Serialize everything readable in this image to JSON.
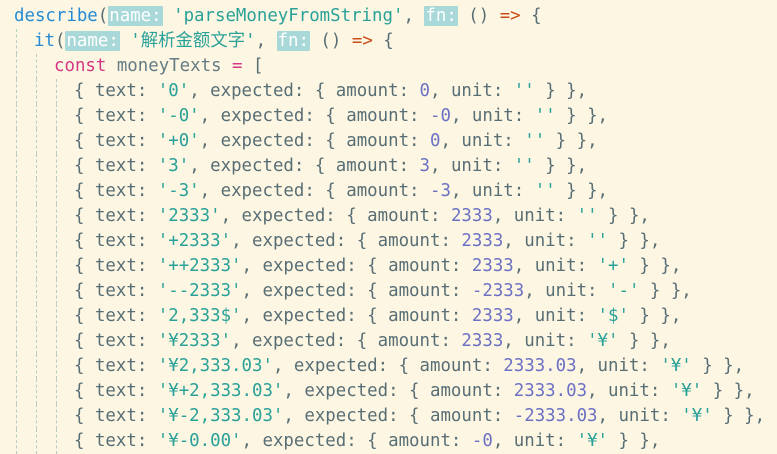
{
  "editor": {
    "theme_colors": {
      "background": "#fdf6e3",
      "keyword": "#d33682",
      "string": "#2aa198",
      "number": "#6c71c4",
      "function": "#268bd2",
      "arrow": "#cb4b16",
      "hint_bg": "#a9d8d8"
    },
    "lines": [
      {
        "indent": 0,
        "tokens": [
          {
            "t": "describe",
            "c": "call"
          },
          {
            "t": "(",
            "c": "punc"
          },
          {
            "t": "name:",
            "c": "hint"
          },
          {
            "t": " ",
            "c": "punc"
          },
          {
            "t": "'parseMoneyFromString'",
            "c": "str"
          },
          {
            "t": ", ",
            "c": "punc"
          },
          {
            "t": "fn:",
            "c": "hint"
          },
          {
            "t": " () ",
            "c": "punc"
          },
          {
            "t": "=>",
            "c": "arrow"
          },
          {
            "t": " {",
            "c": "punc"
          }
        ]
      },
      {
        "indent": 1,
        "tokens": [
          {
            "t": "it",
            "c": "call"
          },
          {
            "t": "(",
            "c": "punc"
          },
          {
            "t": "name:",
            "c": "hint"
          },
          {
            "t": " ",
            "c": "punc"
          },
          {
            "t": "'解析金额文字'",
            "c": "str"
          },
          {
            "t": ", ",
            "c": "punc"
          },
          {
            "t": "fn:",
            "c": "hint"
          },
          {
            "t": " () ",
            "c": "punc"
          },
          {
            "t": "=>",
            "c": "arrow"
          },
          {
            "t": " {",
            "c": "punc"
          }
        ]
      },
      {
        "indent": 2,
        "tokens": [
          {
            "t": "const",
            "c": "kw"
          },
          {
            "t": " moneyTexts ",
            "c": "id"
          },
          {
            "t": "=",
            "c": "kw"
          },
          {
            "t": " [",
            "c": "punc"
          }
        ]
      },
      {
        "indent": 3,
        "tokens": [
          {
            "t": "{ text: ",
            "c": "punc"
          },
          {
            "t": "'0'",
            "c": "str"
          },
          {
            "t": ", expected: { amount: ",
            "c": "punc"
          },
          {
            "t": "0",
            "c": "num"
          },
          {
            "t": ", unit: ",
            "c": "punc"
          },
          {
            "t": "''",
            "c": "str"
          },
          {
            "t": " } },",
            "c": "punc"
          }
        ]
      },
      {
        "indent": 3,
        "tokens": [
          {
            "t": "{ text: ",
            "c": "punc"
          },
          {
            "t": "'-0'",
            "c": "str"
          },
          {
            "t": ", expected: { amount: ",
            "c": "punc"
          },
          {
            "t": "-0",
            "c": "num"
          },
          {
            "t": ", unit: ",
            "c": "punc"
          },
          {
            "t": "''",
            "c": "str"
          },
          {
            "t": " } },",
            "c": "punc"
          }
        ]
      },
      {
        "indent": 3,
        "tokens": [
          {
            "t": "{ text: ",
            "c": "punc"
          },
          {
            "t": "'+0'",
            "c": "str"
          },
          {
            "t": ", expected: { amount: ",
            "c": "punc"
          },
          {
            "t": "0",
            "c": "num"
          },
          {
            "t": ", unit: ",
            "c": "punc"
          },
          {
            "t": "''",
            "c": "str"
          },
          {
            "t": " } },",
            "c": "punc"
          }
        ]
      },
      {
        "indent": 3,
        "tokens": [
          {
            "t": "{ text: ",
            "c": "punc"
          },
          {
            "t": "'3'",
            "c": "str"
          },
          {
            "t": ", expected: { amount: ",
            "c": "punc"
          },
          {
            "t": "3",
            "c": "num"
          },
          {
            "t": ", unit: ",
            "c": "punc"
          },
          {
            "t": "''",
            "c": "str"
          },
          {
            "t": " } },",
            "c": "punc"
          }
        ]
      },
      {
        "indent": 3,
        "tokens": [
          {
            "t": "{ text: ",
            "c": "punc"
          },
          {
            "t": "'-3'",
            "c": "str"
          },
          {
            "t": ", expected: { amount: ",
            "c": "punc"
          },
          {
            "t": "-3",
            "c": "num"
          },
          {
            "t": ", unit: ",
            "c": "punc"
          },
          {
            "t": "''",
            "c": "str"
          },
          {
            "t": " } },",
            "c": "punc"
          }
        ]
      },
      {
        "indent": 3,
        "tokens": [
          {
            "t": "{ text: ",
            "c": "punc"
          },
          {
            "t": "'2333'",
            "c": "str"
          },
          {
            "t": ", expected: { amount: ",
            "c": "punc"
          },
          {
            "t": "2333",
            "c": "num"
          },
          {
            "t": ", unit: ",
            "c": "punc"
          },
          {
            "t": "''",
            "c": "str"
          },
          {
            "t": " } },",
            "c": "punc"
          }
        ]
      },
      {
        "indent": 3,
        "tokens": [
          {
            "t": "{ text: ",
            "c": "punc"
          },
          {
            "t": "'+2333'",
            "c": "str"
          },
          {
            "t": ", expected: { amount: ",
            "c": "punc"
          },
          {
            "t": "2333",
            "c": "num"
          },
          {
            "t": ", unit: ",
            "c": "punc"
          },
          {
            "t": "''",
            "c": "str"
          },
          {
            "t": " } },",
            "c": "punc"
          }
        ]
      },
      {
        "indent": 3,
        "tokens": [
          {
            "t": "{ text: ",
            "c": "punc"
          },
          {
            "t": "'++2333'",
            "c": "str"
          },
          {
            "t": ", expected: { amount: ",
            "c": "punc"
          },
          {
            "t": "2333",
            "c": "num"
          },
          {
            "t": ", unit: ",
            "c": "punc"
          },
          {
            "t": "'+'",
            "c": "str"
          },
          {
            "t": " } },",
            "c": "punc"
          }
        ]
      },
      {
        "indent": 3,
        "tokens": [
          {
            "t": "{ text: ",
            "c": "punc"
          },
          {
            "t": "'--2333'",
            "c": "str"
          },
          {
            "t": ", expected: { amount: ",
            "c": "punc"
          },
          {
            "t": "-2333",
            "c": "num"
          },
          {
            "t": ", unit: ",
            "c": "punc"
          },
          {
            "t": "'-'",
            "c": "str"
          },
          {
            "t": " } },",
            "c": "punc"
          }
        ]
      },
      {
        "indent": 3,
        "tokens": [
          {
            "t": "{ text: ",
            "c": "punc"
          },
          {
            "t": "'2,333$'",
            "c": "str"
          },
          {
            "t": ", expected: { amount: ",
            "c": "punc"
          },
          {
            "t": "2333",
            "c": "num"
          },
          {
            "t": ", unit: ",
            "c": "punc"
          },
          {
            "t": "'$'",
            "c": "str"
          },
          {
            "t": " } },",
            "c": "punc"
          }
        ]
      },
      {
        "indent": 3,
        "tokens": [
          {
            "t": "{ text: ",
            "c": "punc"
          },
          {
            "t": "'¥2333'",
            "c": "str"
          },
          {
            "t": ", expected: { amount: ",
            "c": "punc"
          },
          {
            "t": "2333",
            "c": "num"
          },
          {
            "t": ", unit: ",
            "c": "punc"
          },
          {
            "t": "'¥'",
            "c": "str"
          },
          {
            "t": " } },",
            "c": "punc"
          }
        ]
      },
      {
        "indent": 3,
        "tokens": [
          {
            "t": "{ text: ",
            "c": "punc"
          },
          {
            "t": "'¥2,333.03'",
            "c": "str"
          },
          {
            "t": ", expected: { amount: ",
            "c": "punc"
          },
          {
            "t": "2333.03",
            "c": "num"
          },
          {
            "t": ", unit: ",
            "c": "punc"
          },
          {
            "t": "'¥'",
            "c": "str"
          },
          {
            "t": " } },",
            "c": "punc"
          }
        ]
      },
      {
        "indent": 3,
        "tokens": [
          {
            "t": "{ text: ",
            "c": "punc"
          },
          {
            "t": "'¥+2,333.03'",
            "c": "str"
          },
          {
            "t": ", expected: { amount: ",
            "c": "punc"
          },
          {
            "t": "2333.03",
            "c": "num"
          },
          {
            "t": ", unit: ",
            "c": "punc"
          },
          {
            "t": "'¥'",
            "c": "str"
          },
          {
            "t": " } },",
            "c": "punc"
          }
        ]
      },
      {
        "indent": 3,
        "tokens": [
          {
            "t": "{ text: ",
            "c": "punc"
          },
          {
            "t": "'¥-2,333.03'",
            "c": "str"
          },
          {
            "t": ", expected: { amount: ",
            "c": "punc"
          },
          {
            "t": "-2333.03",
            "c": "num"
          },
          {
            "t": ", unit: ",
            "c": "punc"
          },
          {
            "t": "'¥'",
            "c": "str"
          },
          {
            "t": " } },",
            "c": "punc"
          }
        ]
      },
      {
        "indent": 3,
        "tokens": [
          {
            "t": "{ text: ",
            "c": "punc"
          },
          {
            "t": "'¥-0.00'",
            "c": "str"
          },
          {
            "t": ", expected: { amount: ",
            "c": "punc"
          },
          {
            "t": "-0",
            "c": "num"
          },
          {
            "t": ", unit: ",
            "c": "punc"
          },
          {
            "t": "'¥'",
            "c": "str"
          },
          {
            "t": " } },",
            "c": "punc"
          }
        ]
      }
    ]
  }
}
